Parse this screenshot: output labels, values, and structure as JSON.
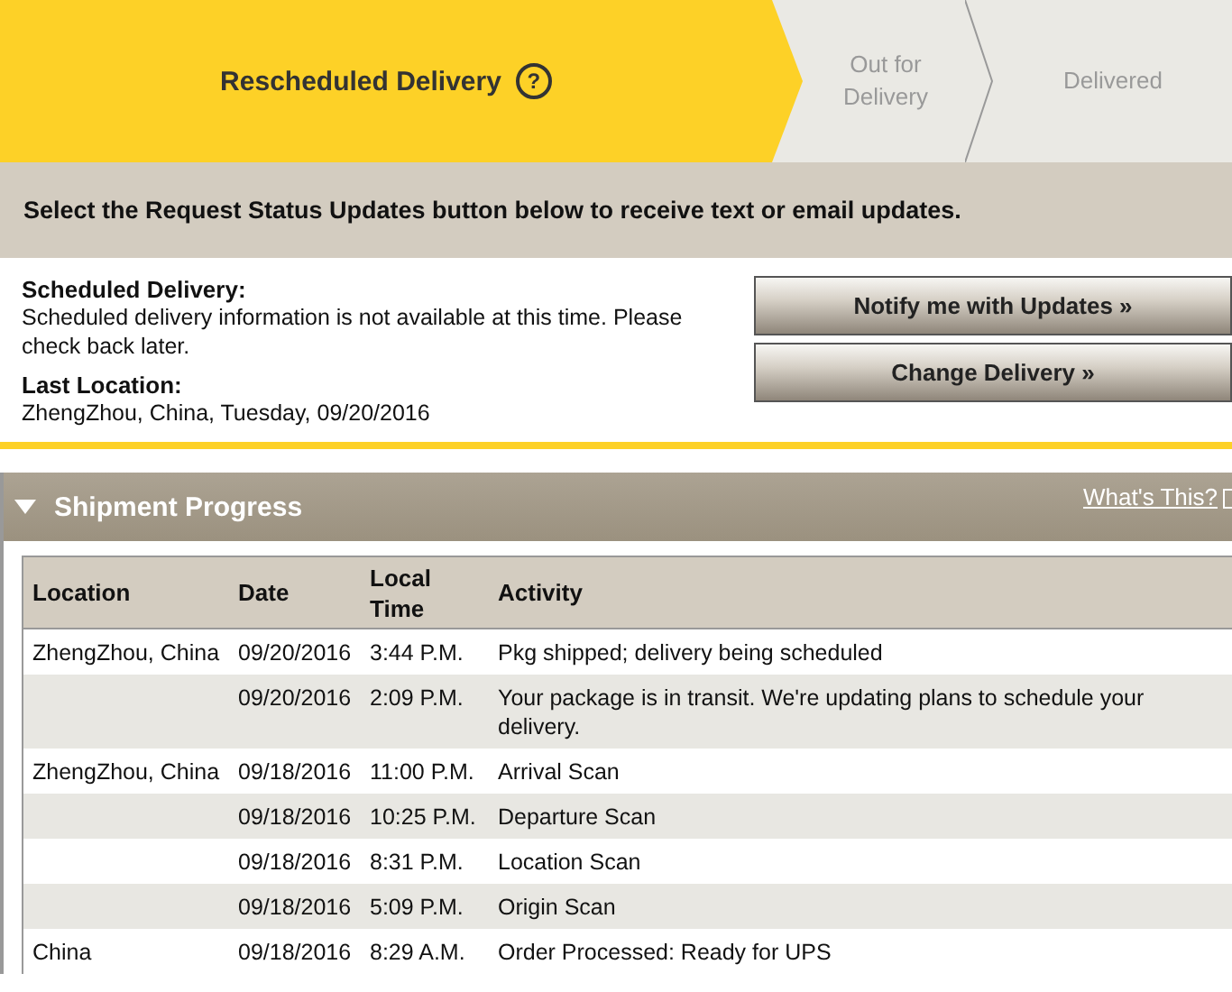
{
  "progress_steps": [
    {
      "label": "Rescheduled Delivery",
      "selected": true,
      "help": "?"
    },
    {
      "label": "Out for Delivery",
      "selected": false
    },
    {
      "label": "Delivered",
      "selected": false
    }
  ],
  "notice": "Select the Request Status Updates button below to receive text or email updates.",
  "details": [
    {
      "label": "Scheduled Delivery:",
      "value": "Scheduled delivery information is not available at this time. Please check back later."
    },
    {
      "label": "Last Location:",
      "value": "ZhengZhou, China, Tuesday, 09/20/2016"
    }
  ],
  "buttons": [
    "Notify me with Updates »",
    "Change Delivery »"
  ],
  "shipment_progress": {
    "title": "Shipment Progress",
    "expanded": true,
    "help_link": "What's This?",
    "columns": [
      "Location",
      "Date",
      "Local Time",
      "Activity"
    ],
    "rows": [
      [
        "ZhengZhou, China",
        "09/20/2016",
        "3:44 P.M.",
        "Pkg shipped; delivery being scheduled"
      ],
      [
        "",
        "09/20/2016",
        "2:09 P.M.",
        "Your package is in transit. We're updating plans to schedule your delivery."
      ],
      [
        "ZhengZhou, China",
        "09/18/2016",
        "11:00 P.M.",
        "Arrival Scan"
      ],
      [
        "",
        "09/18/2016",
        "10:25 P.M.",
        "Departure Scan"
      ],
      [
        "",
        "09/18/2016",
        "8:31 P.M.",
        "Location Scan"
      ],
      [
        "",
        "09/18/2016",
        "5:09 P.M.",
        "Origin Scan"
      ],
      [
        "China",
        "09/18/2016",
        "8:29 A.M.",
        "Order Processed: Ready for UPS"
      ]
    ]
  }
}
